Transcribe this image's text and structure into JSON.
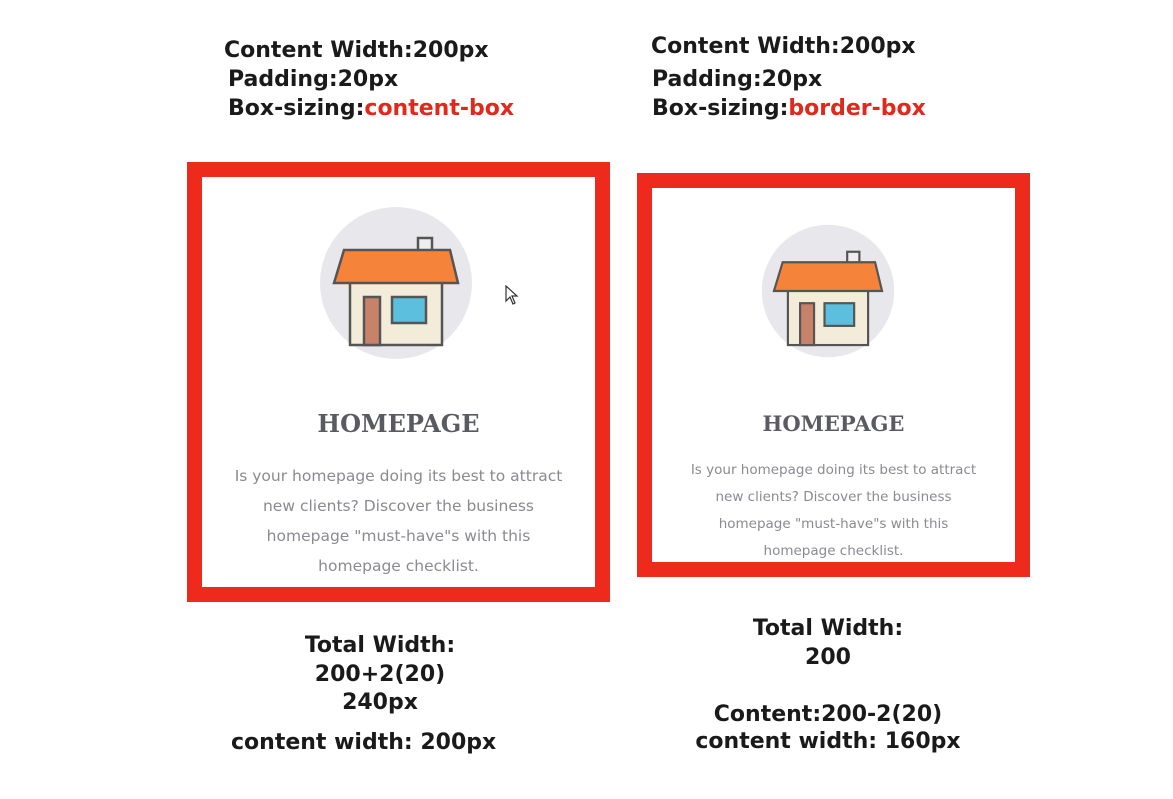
{
  "left": {
    "content_width_label": "Content Width:200px",
    "padding_label": "Padding:20px",
    "box_sizing_prefix": "Box-sizing:",
    "box_sizing_value": "content-box",
    "card": {
      "icon": "house-icon",
      "title": "HOMEPAGE",
      "text_lines": [
        "Is your homepage doing its best to attract",
        "new clients? Discover the business",
        "homepage \"must-have\"s with this",
        "homepage checklist."
      ]
    },
    "total_width_label": "Total Width:",
    "total_width_formula": "200+2(20)",
    "total_width_result": "240px",
    "content_width_result": "content width: 200px"
  },
  "right": {
    "content_width_label": "Content Width:200px",
    "padding_label": "Padding:20px",
    "box_sizing_prefix": "Box-sizing:",
    "box_sizing_value": "border-box",
    "card": {
      "icon": "house-icon",
      "title": "HOMEPAGE",
      "text_lines": [
        "Is your homepage doing its best to attract",
        "new clients? Discover the business",
        "homepage \"must-have\"s with this",
        "homepage checklist."
      ]
    },
    "total_width_label": "Total Width:",
    "total_width_value": "200",
    "content_formula": "Content:200-2(20)",
    "content_width_result": "content width: 160px"
  },
  "colors": {
    "border": "#ee2a1d",
    "highlight": "#e0281c",
    "roof": "#f5843a",
    "house_wall": "#f3ecd9",
    "window": "#5bc0de",
    "door": "#c9826a",
    "icon_circle": "#e8e8ec"
  },
  "cursor_icon": "mouse-pointer-icon"
}
